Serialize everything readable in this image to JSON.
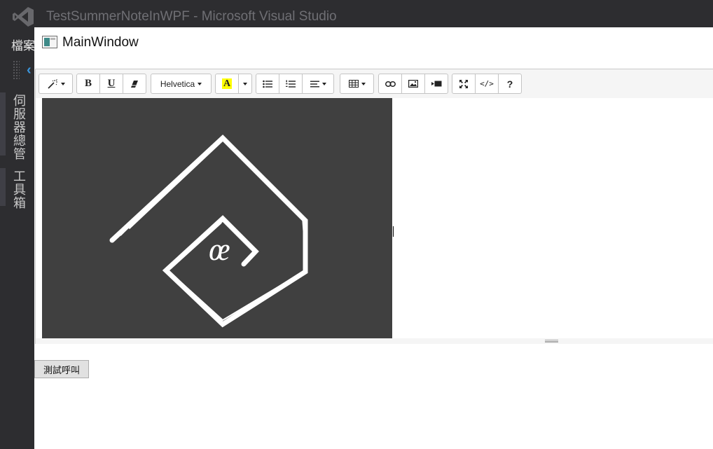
{
  "vs": {
    "title": "TestSummerNoteInWPF - Microsoft Visual Studio",
    "menu_file": "檔案",
    "side_tabs": [
      {
        "label": "伺服器總管"
      },
      {
        "label": "工具箱"
      }
    ],
    "accent": "#3a96dd"
  },
  "window": {
    "title": "MainWindow"
  },
  "editor": {
    "toolbar": {
      "style_icon": "magic-wand-icon",
      "bold": "B",
      "underline": "U",
      "eraser_icon": "eraser-icon",
      "font_name": "Helvetica",
      "color_letter": "A",
      "color_highlight": "#ffff00",
      "ul_icon": "unordered-list-icon",
      "ol_icon": "ordered-list-icon",
      "align_icon": "align-left-icon",
      "table_icon": "table-icon",
      "link_icon": "link-icon",
      "picture_icon": "picture-icon",
      "video_icon": "video-icon",
      "fullscreen_icon": "fullscreen-icon",
      "codeview": "</>",
      "help": "?"
    },
    "image": {
      "logo_text": "œ",
      "background": "#404040"
    }
  },
  "test_button": "測試呼叫"
}
